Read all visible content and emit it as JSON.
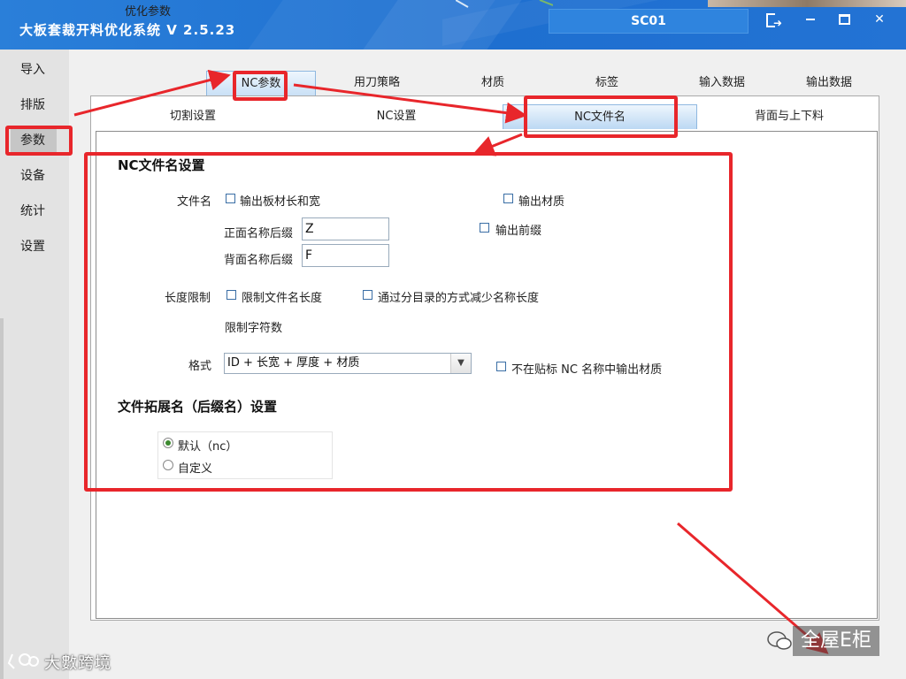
{
  "titlebar": {
    "app_title": "大板套裁开料优化系统  V 2.5.23",
    "center_label": "SC01",
    "controls": [
      "exit-icon",
      "minimize-icon",
      "maximize-icon",
      "close-icon"
    ]
  },
  "sidebar": {
    "items": [
      {
        "label": "导入"
      },
      {
        "label": "排版"
      },
      {
        "label": "参数",
        "active": true
      },
      {
        "label": "设备"
      },
      {
        "label": "统计"
      },
      {
        "label": "设置"
      }
    ]
  },
  "tabs_top": [
    {
      "label": "优化参数"
    },
    {
      "label": "NC参数",
      "active": true
    },
    {
      "label": "用刀策略"
    },
    {
      "label": "材质"
    },
    {
      "label": "标签"
    },
    {
      "label": "输入数据"
    },
    {
      "label": "输出数据"
    }
  ],
  "tabs_sub": [
    {
      "label": "切割设置"
    },
    {
      "label": "NC设置"
    },
    {
      "label": "NC文件名",
      "active": true
    },
    {
      "label": "背面与上下料"
    }
  ],
  "nc_filename": {
    "section_title": "NC文件名设置",
    "filename_label": "文件名",
    "output_size_label": "输出板材长和宽",
    "output_material_label": "输出材质",
    "front_suffix_label": "正面名称后缀",
    "front_suffix_value": "Z",
    "back_suffix_label": "背面名称后缀",
    "back_suffix_value": "F",
    "output_prefix_label": "输出前缀",
    "length_limit_label": "长度限制",
    "limit_length_label": "限制文件名长度",
    "subdir_label": "通过分目录的方式减少名称长度",
    "char_limit_label": "限制字符数",
    "format_label": "格式",
    "format_value": "ID + 长宽 + 厚度 + 材质",
    "no_material_label": "不在贴标 NC 名称中输出材质"
  },
  "extension": {
    "section_title": "文件拓展名（后缀名）设置",
    "options": [
      {
        "label": "默认（nc）",
        "selected": true
      },
      {
        "label": "自定义",
        "selected": false
      }
    ]
  },
  "watermarks": {
    "right": "全屋E柜",
    "left": "大數跨境"
  },
  "colors": {
    "titlebar": "#1e6fd0",
    "annotation": "#e8262b",
    "active_tab": "#c9e0f6",
    "radio_selected": "#3c8a2f"
  }
}
